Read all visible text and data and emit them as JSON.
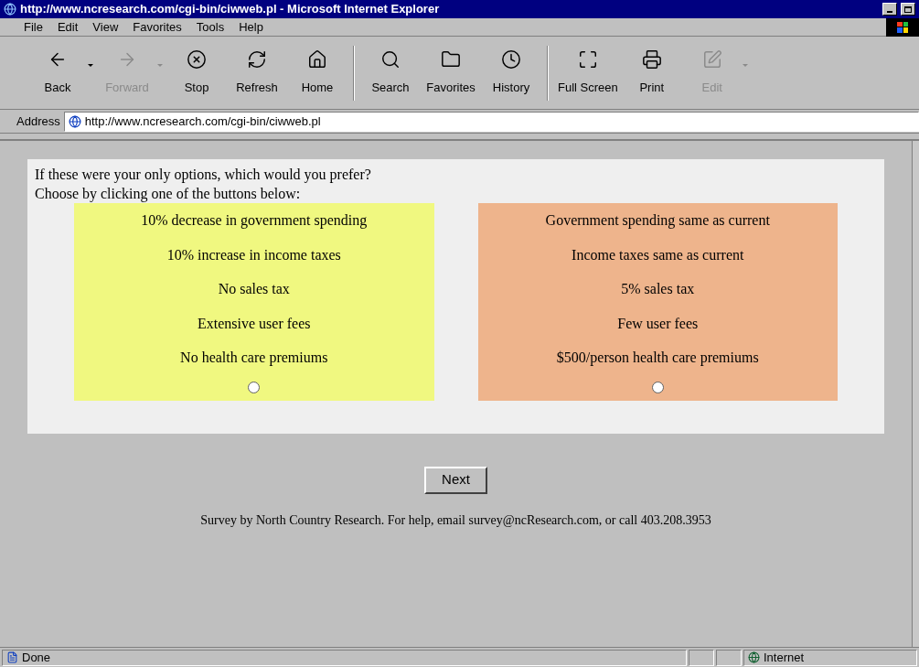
{
  "window": {
    "title": "http://www.ncresearch.com/cgi-bin/ciwweb.pl - Microsoft Internet Explorer"
  },
  "menu": [
    "File",
    "Edit",
    "View",
    "Favorites",
    "Tools",
    "Help"
  ],
  "toolbar": [
    {
      "label": "Back",
      "kind": "back",
      "disabled": false,
      "dropdown": true
    },
    {
      "label": "Forward",
      "kind": "forward",
      "disabled": true,
      "dropdown": true
    },
    {
      "label": "Stop",
      "kind": "stop",
      "disabled": false,
      "dropdown": false
    },
    {
      "label": "Refresh",
      "kind": "refresh",
      "disabled": false,
      "dropdown": false
    },
    {
      "label": "Home",
      "kind": "home",
      "disabled": false,
      "dropdown": false
    },
    {
      "label": "Search",
      "kind": "search",
      "disabled": false,
      "dropdown": false
    },
    {
      "label": "Favorites",
      "kind": "favorites",
      "disabled": false,
      "dropdown": false
    },
    {
      "label": "History",
      "kind": "history",
      "disabled": false,
      "dropdown": false
    },
    {
      "label": "Full Screen",
      "kind": "fullscreen",
      "disabled": false,
      "dropdown": false
    },
    {
      "label": "Print",
      "kind": "print",
      "disabled": false,
      "dropdown": false
    },
    {
      "label": "Edit",
      "kind": "edit",
      "disabled": true,
      "dropdown": true
    }
  ],
  "address": {
    "label": "Address",
    "value": "http://www.ncresearch.com/cgi-bin/ciwweb.pl"
  },
  "survey": {
    "question": [
      "If these were your only options, which would you prefer?",
      "Choose by clicking one of the buttons below:"
    ],
    "options": [
      {
        "color": "#f0f880",
        "selected": false,
        "lines": [
          "10% decrease in government spending",
          "10% increase in income taxes",
          "No sales tax",
          "Extensive user fees",
          "No health care premiums"
        ]
      },
      {
        "color": "#eeb48c",
        "selected": false,
        "lines": [
          "Government spending same as current",
          "Income taxes same as current",
          "5% sales tax",
          "Few user fees",
          "$500/person health care premiums"
        ]
      }
    ],
    "next_button": "Next",
    "footer": "Survey by North Country Research. For help, email survey@ncResearch.com, or call 403.208.3953"
  },
  "status_bar": {
    "text": "Done",
    "zone": "Internet"
  }
}
